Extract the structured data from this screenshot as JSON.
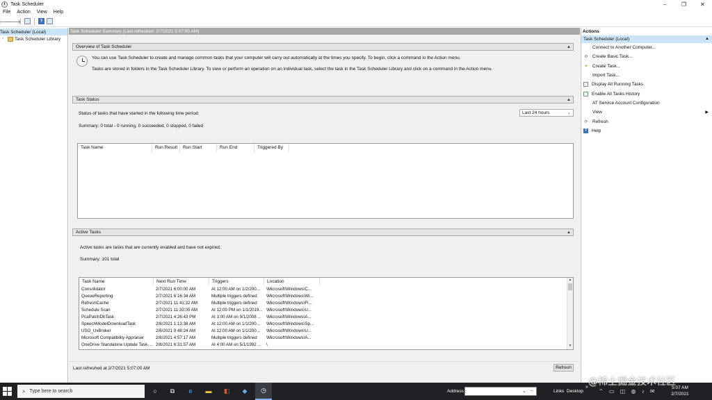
{
  "window": {
    "title": "Task Scheduler",
    "controls": {
      "minimize": "–",
      "maximize": "❐",
      "close": "✕"
    }
  },
  "menu": [
    "File",
    "Action",
    "View",
    "Help"
  ],
  "tree": {
    "items": [
      {
        "label": "Task Scheduler (Local)",
        "icon": "clock-icon"
      },
      {
        "label": "Task Scheduler Library",
        "icon": "folder-icon"
      }
    ]
  },
  "center": {
    "header": "Task Scheduler Summary (Last refreshed: 2/7/2021 5:07:00 AM)",
    "overview": {
      "title": "Overview of Task Scheduler",
      "line1": "You can use Task Scheduler to create and manage common tasks that your computer will carry out automatically at the times you specify. To begin, click a command in the Action menu.",
      "line2": "Tasks are stored in folders in the Task Scheduler Library. To view or perform an operation on an individual task, select the task in the Task Scheduler Library and click on a command in the Action menu."
    },
    "status": {
      "title": "Task Status",
      "prompt": "Status of tasks that have started in the following time period:",
      "period": "Last 24 hours",
      "summary": "Summary: 0 total - 0 running, 0 succeeded, 0 stopped, 0 failed",
      "columns": [
        "Task Name",
        "Run Result",
        "Run Start",
        "Run End",
        "Triggered By"
      ]
    },
    "active": {
      "title": "Active Tasks",
      "description": "Active tasks are tasks that are currently enabled and have not expired.",
      "summary": "Summary: 101 total",
      "columns": [
        "Task Name",
        "Next Run Time",
        "Triggers",
        "Location"
      ],
      "rows": [
        [
          "Consolidator",
          "2/7/2021 6:00:00 AM",
          "At 12:00 AM on 1/2/200...",
          "\\Microsoft\\Windows\\C..."
        ],
        [
          "QueueReporting",
          "2/7/2021 6:16:34 AM",
          "Multiple triggers defined",
          "\\Microsoft\\Windows\\Wi..."
        ],
        [
          "RefreshCache",
          "2/7/2021 11:41:32 AM",
          "Multiple triggers defined",
          "\\Microsoft\\Windows\\Fl..."
        ],
        [
          "Schedule Scan",
          "2/7/2021 11:33:05 AM",
          "At 12:00 PM on 1/1/2019...",
          "\\Microsoft\\Windows\\U..."
        ],
        [
          "PcaPatchDbTask",
          "2/7/2021 4:26:43 PM",
          "At 3:00 AM on 9/1/2008 ...",
          "\\Microsoft\\Windows\\A..."
        ],
        [
          "SpeechModelDownloadTask",
          "2/8/2021 1:13:38 AM",
          "At 12:00 AM on 1/1/200...",
          "\\Microsoft\\Windows\\Sp..."
        ],
        [
          "USO_UxBroker",
          "2/8/2021 9:48:24 AM",
          "At 12:00 AM on 1/1/200...",
          "\\Microsoft\\Windows\\U..."
        ],
        [
          "Microsoft Compatibility Appraiser",
          "2/8/2021 4:57:17 AM",
          "Multiple triggers defined",
          "\\Microsoft\\Windows\\A..."
        ],
        [
          "OneDrive Standalone Update Task-...",
          "2/8/2021 6:31:57 AM",
          "At 4:00 AM on 5/1/1992 ...",
          "\\"
        ]
      ]
    },
    "footer": "Last refreshed at 2/7/2021 5:07:00 AM",
    "refresh_button": "Refresh"
  },
  "actions": {
    "title": "Actions",
    "group": "Task Scheduler (Local)",
    "items": [
      {
        "label": "Connect to Another Computer...",
        "icon": "none"
      },
      {
        "label": "Create Basic Task...",
        "icon": "create-basic-task-icon"
      },
      {
        "label": "Create Task...",
        "icon": "create-task-icon"
      },
      {
        "label": "Import Task...",
        "icon": "none"
      },
      {
        "label": "Display All Running Tasks",
        "icon": "running-tasks-icon"
      },
      {
        "label": "Enable All Tasks History",
        "icon": "history-icon"
      },
      {
        "label": "AT Service Account Configuration",
        "icon": "none"
      },
      {
        "label": "View",
        "icon": "none",
        "submenu": true
      },
      {
        "label": "Refresh",
        "icon": "refresh-icon"
      },
      {
        "label": "Help",
        "icon": "help-icon"
      }
    ]
  },
  "taskbar": {
    "search_placeholder": "Type here to search",
    "address_label": "Address",
    "links": "Links",
    "desktop": "Desktop",
    "chevron": "»",
    "time": "5:07 AM",
    "date": "2/7/2021"
  },
  "watermark": "@稀土掘金技术社区"
}
